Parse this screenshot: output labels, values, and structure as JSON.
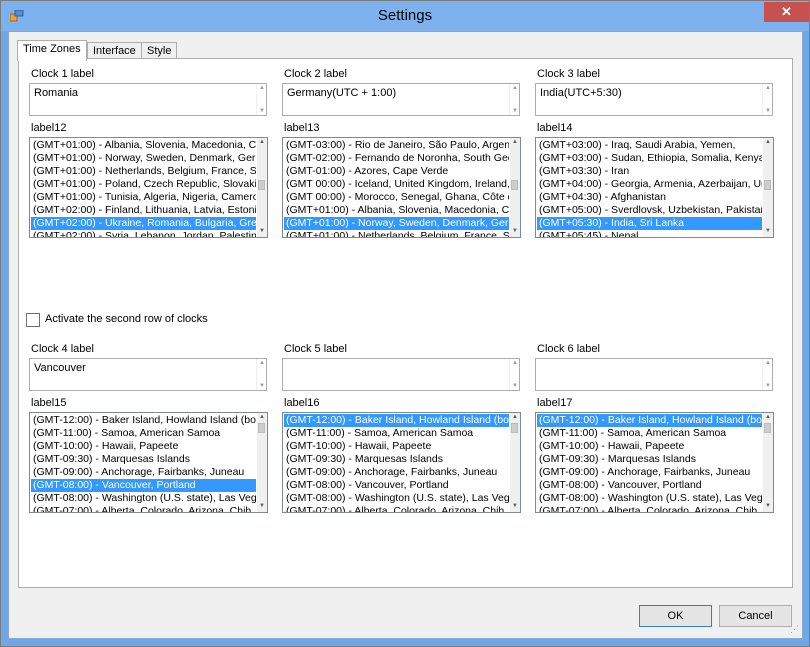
{
  "window": {
    "title": "Settings",
    "close_glyph": "✕"
  },
  "tabs": [
    "Time Zones",
    "Interface",
    "Style"
  ],
  "clocks_top": [
    {
      "label": "Clock 1 label",
      "value": "Romania",
      "list_label": "label12",
      "items": [
        "(GMT+01:00) - Albania, Slovenia, Macedonia, Cr",
        "(GMT+01:00) - Norway, Sweden, Denmark, Gern",
        "(GMT+01:00) - Netherlands, Belgium, France, Sw",
        "(GMT+01:00) - Poland, Czech Republic, Slovakia",
        "(GMT+01:00) - Tunisia, Algeria, Nigeria, Camerou",
        "(GMT+02:00) - Finland, Lithuania, Latvia, Estonia",
        "(GMT+02:00) - Ukraine, Romania, Bulgaria, Gree",
        "(GMT+02:00) - Syria, Lebanon, Jordan, Palestine"
      ],
      "selected": 6
    },
    {
      "label": "Clock 2 label",
      "value": "Germany(UTC + 1:00)",
      "list_label": "label13",
      "items": [
        "(GMT-03:00) - Rio de Janeiro, São Paulo, Argent",
        "(GMT-02:00) - Fernando de Noronha, South Geo",
        "(GMT-01:00) - Azores, Cape Verde",
        "(GMT 00:00) - Iceland, United Kingdom, Ireland,",
        "(GMT 00:00) - Morocco, Senegal, Ghana, Côte d",
        "(GMT+01:00) - Albania, Slovenia, Macedonia, Cr",
        "(GMT+01:00) - Norway, Sweden, Denmark, Germ",
        "(GMT+01:00) - Netherlands, Belgium, France, Sw"
      ],
      "selected": 6
    },
    {
      "label": "Clock 3 label",
      "value": "India(UTC+5:30)",
      "list_label": "label14",
      "items": [
        "(GMT+03:00) - Iraq, Saudi Arabia, Yemen,",
        "(GMT+03:00) - Sudan, Ethiopia, Somalia, Kenya,",
        "(GMT+03:30) - Iran",
        "(GMT+04:00) - Georgia, Armenia, Azerbaijan, Un",
        "(GMT+04:30) - Afghanistan",
        "(GMT+05:00) - Sverdlovsk, Uzbekistan, Pakistan",
        "(GMT+05:30) - India, Sri Lanka",
        "(GMT+05:45) - Nepal"
      ],
      "selected": 6
    }
  ],
  "second_row_checkbox": "Activate the second row of clocks",
  "clocks_bottom": [
    {
      "label": "Clock 4 label",
      "value": "Vancouver",
      "list_label": "label15",
      "items": [
        "(GMT-12:00) - Baker Island, Howland Island (bot",
        "(GMT-11:00) - Samoa, American Samoa",
        "(GMT-10:00) - Hawaii, Papeete",
        "(GMT-09:30) - Marquesas Islands",
        "(GMT-09:00) - Anchorage, Fairbanks, Juneau",
        "(GMT-08:00) - Vancouver, Portland",
        "(GMT-08:00) - Washington (U.S. state), Las Veg",
        "(GMT-07:00) - Alberta, Colorado, Arizona, Chih"
      ],
      "selected": 5
    },
    {
      "label": "Clock 5 label",
      "value": "",
      "list_label": "label16",
      "items": [
        "(GMT-12:00) - Baker Island, Howland Island (bot",
        "(GMT-11:00) - Samoa, American Samoa",
        "(GMT-10:00) - Hawaii, Papeete",
        "(GMT-09:30) - Marquesas Islands",
        "(GMT-09:00) - Anchorage, Fairbanks, Juneau",
        "(GMT-08:00) - Vancouver, Portland",
        "(GMT-08:00) - Washington (U.S. state), Las Veg",
        "(GMT-07:00) - Alberta, Colorado, Arizona, Chih"
      ],
      "selected": 0
    },
    {
      "label": "Clock 6 label",
      "value": "",
      "list_label": "label17",
      "items": [
        "(GMT-12:00) - Baker Island, Howland Island (bot",
        "(GMT-11:00) - Samoa, American Samoa",
        "(GMT-10:00) - Hawaii, Papeete",
        "(GMT-09:30) - Marquesas Islands",
        "(GMT-09:00) - Anchorage, Fairbanks, Juneau",
        "(GMT-08:00) - Vancouver, Portland",
        "(GMT-08:00) - Washington (U.S. state), Las Veg",
        "(GMT-07:00) - Alberta, Colorado, Arizona, Chih"
      ],
      "selected": 0
    }
  ],
  "buttons": {
    "ok": "OK",
    "cancel": "Cancel"
  },
  "colors": {
    "title_bar": "#7db2ef",
    "selection": "#3399ff",
    "close_button": "#c75050"
  }
}
